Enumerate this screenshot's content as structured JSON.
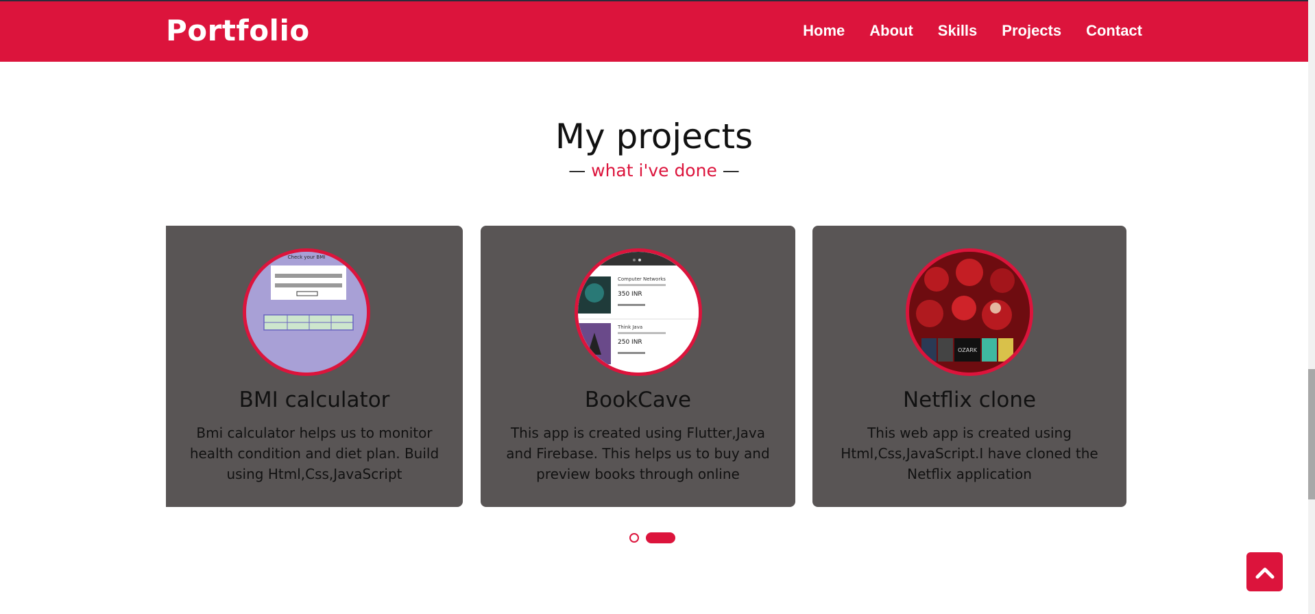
{
  "navbar": {
    "logo": "Portfolio",
    "items": [
      {
        "label": "Home"
      },
      {
        "label": "About"
      },
      {
        "label": "Skills"
      },
      {
        "label": "Projects"
      },
      {
        "label": "Contact"
      }
    ],
    "bg_color": "#dc143c"
  },
  "section": {
    "title": "My projects",
    "subtitle_prefix": "— ",
    "subtitle_accent": "what i've done",
    "subtitle_suffix": " —"
  },
  "projects": [
    {
      "title": "BMI calculator",
      "description": "Bmi calculator helps us to monitor health condition and diet plan. Build using Html,Css,JavaScript",
      "thumb_text": "Check your BMI"
    },
    {
      "title": "BookCave",
      "description": "This app is created using Flutter,Java and Firebase. This helps us to buy and preview books through online",
      "thumb_items": [
        {
          "name": "Computer Networks",
          "price": "350 INR"
        },
        {
          "name": "Think Java",
          "price": "250 INR"
        }
      ]
    },
    {
      "title": "Netflix clone",
      "description": "This web app is created using Html,Css,JavaScript.I have cloned the Netflix application",
      "thumb_text": "OZARK"
    }
  ],
  "carousel": {
    "pages": 2,
    "active_page": 2
  },
  "icons": {
    "back_to_top": "chevron-up-icon"
  },
  "colors": {
    "accent": "#dc143c",
    "card_bg": "#595555"
  }
}
